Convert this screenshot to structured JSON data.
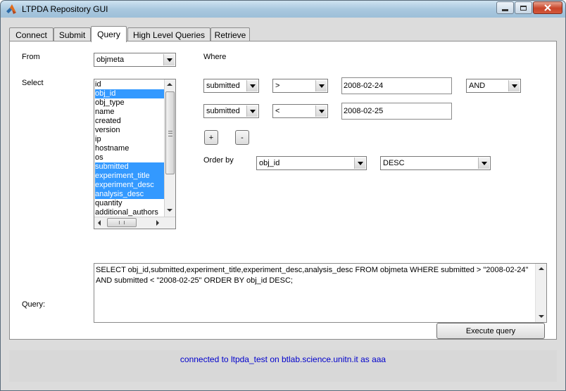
{
  "window": {
    "title": "LTPDA Repository GUI",
    "controls": {
      "minimize": "minimize-icon",
      "maximize": "maximize-icon",
      "close": "close-icon"
    }
  },
  "tabs": [
    {
      "label": "Connect",
      "active": false
    },
    {
      "label": "Submit",
      "active": false
    },
    {
      "label": "Query",
      "active": true
    },
    {
      "label": "High Level Queries",
      "active": false
    },
    {
      "label": "Retrieve",
      "active": false
    }
  ],
  "query_tab": {
    "from_label": "From",
    "from_value": "objmeta",
    "where_label": "Where",
    "select_label": "Select",
    "select_options": [
      {
        "text": "id",
        "selected": false
      },
      {
        "text": "obj_id",
        "selected": true
      },
      {
        "text": "obj_type",
        "selected": false
      },
      {
        "text": "name",
        "selected": false
      },
      {
        "text": "created",
        "selected": false
      },
      {
        "text": "version",
        "selected": false
      },
      {
        "text": "ip",
        "selected": false
      },
      {
        "text": "hostname",
        "selected": false
      },
      {
        "text": "os",
        "selected": false
      },
      {
        "text": "submitted",
        "selected": true
      },
      {
        "text": "experiment_title",
        "selected": true
      },
      {
        "text": "experiment_desc",
        "selected": true
      },
      {
        "text": "analysis_desc",
        "selected": true
      },
      {
        "text": "quantity",
        "selected": false
      },
      {
        "text": "additional_authors",
        "selected": false
      }
    ],
    "conditions": [
      {
        "field": "submitted",
        "operator": ">",
        "value": "2008-02-24",
        "logic": "AND"
      },
      {
        "field": "submitted",
        "operator": "<",
        "value": "2008-02-25"
      }
    ],
    "add_condition_label": "+",
    "remove_condition_label": "-",
    "order_by_label": "Order by",
    "order_by_field": "obj_id",
    "order_direction": "DESC",
    "query_label": "Query:",
    "query_text": "SELECT obj_id,submitted,experiment_title,experiment_desc,analysis_desc FROM objmeta WHERE submitted > \"2008-02-24\" AND submitted < \"2008-02-25\" ORDER BY obj_id DESC;",
    "execute_label": "Execute query"
  },
  "status": {
    "text": "connected to ltpda_test on btlab.science.unitn.it as aaa",
    "color": "#0000cc"
  },
  "colors": {
    "selection": "#3399ff",
    "background": "#dcdcdc"
  }
}
